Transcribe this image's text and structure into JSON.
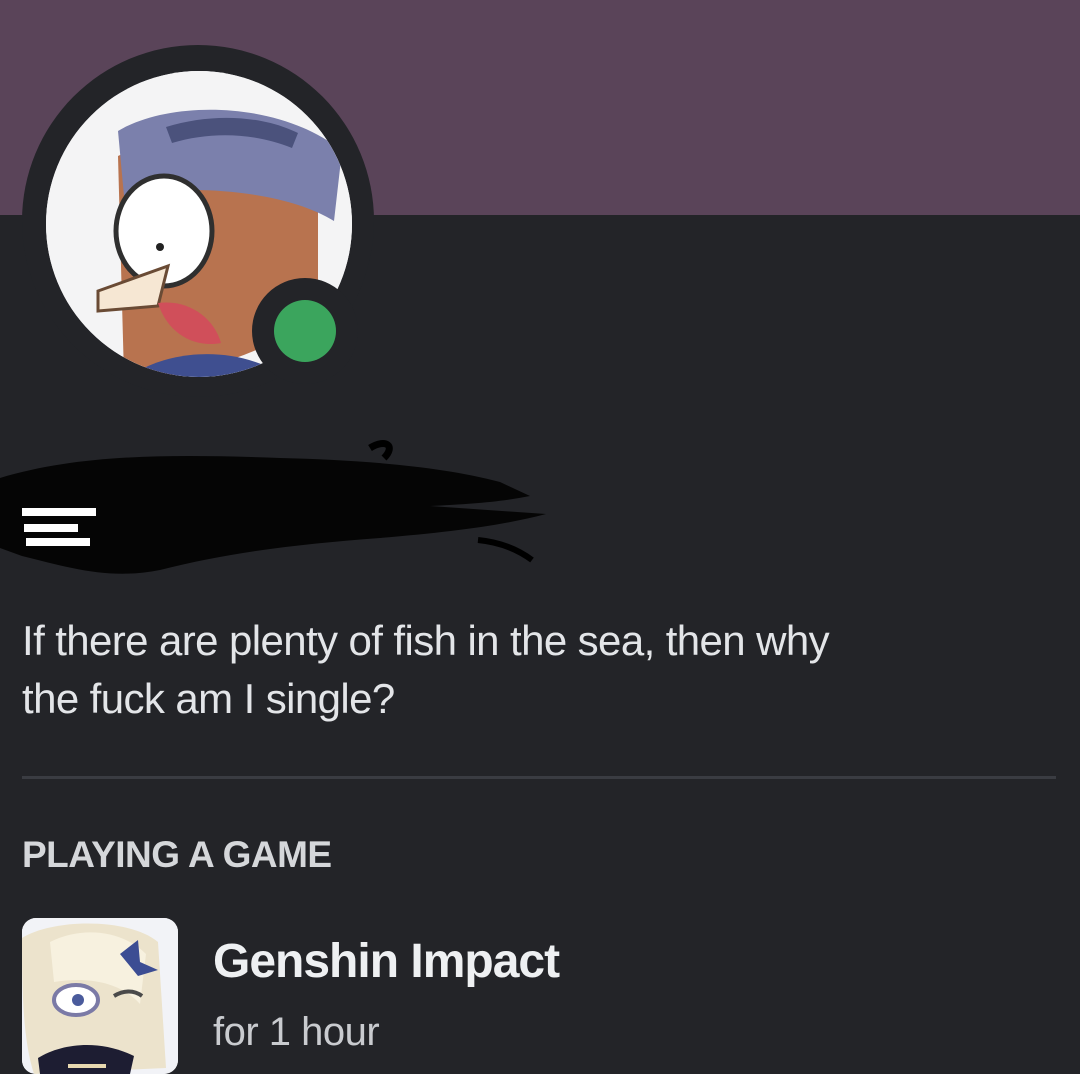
{
  "profile": {
    "avatar_icon": "avatar-cartoon-shocked-character",
    "status": "online",
    "status_color": "#3ba55d",
    "banner_color": "#5a4459",
    "username": "",
    "bio_lines": [
      "If there are plenty of fish in the sea, then why",
      "the fuck am I single?"
    ]
  },
  "activity": {
    "section_title": "PLAYING A GAME",
    "game_icon": "game-icon-paimon",
    "game_name": "Genshin Impact",
    "duration": "for 1 hour"
  }
}
